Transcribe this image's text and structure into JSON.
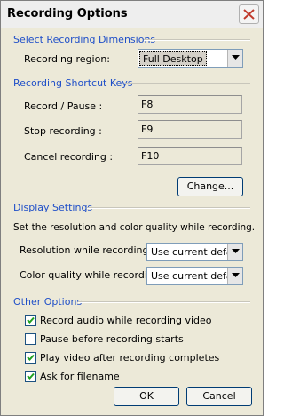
{
  "window": {
    "title": "Recording Options"
  },
  "dimensions": {
    "section_title": "Select Recording Dimensions",
    "region_label": "Recording region:",
    "region_value": "Full Desktop"
  },
  "shortcuts": {
    "section_title": "Recording Shortcut Keys",
    "record_pause_label": "Record / Pause :",
    "record_pause_key": "F8",
    "stop_label": "Stop recording :",
    "stop_key": "F9",
    "cancel_label": "Cancel recording :",
    "cancel_key": "F10",
    "change_button": "Change..."
  },
  "display": {
    "section_title": "Display Settings",
    "description": "Set the resolution and color quality while recording.",
    "resolution_label": "Resolution while recording:",
    "resolution_value": "Use current defau",
    "color_label": "Color quality while recording:",
    "color_value": "Use current defau"
  },
  "other": {
    "section_title": "Other Options",
    "options": [
      {
        "label": "Record audio while recording video",
        "checked": true
      },
      {
        "label": "Pause before recording starts",
        "checked": false
      },
      {
        "label": "Play video after recording completes",
        "checked": true
      },
      {
        "label": "Ask for filename",
        "checked": true
      }
    ]
  },
  "buttons": {
    "ok": "OK",
    "cancel": "Cancel"
  },
  "colors": {
    "section_title": "#1f4fc8",
    "dialog_bg": "#ece9d8",
    "close_icon": "#c0392b"
  }
}
